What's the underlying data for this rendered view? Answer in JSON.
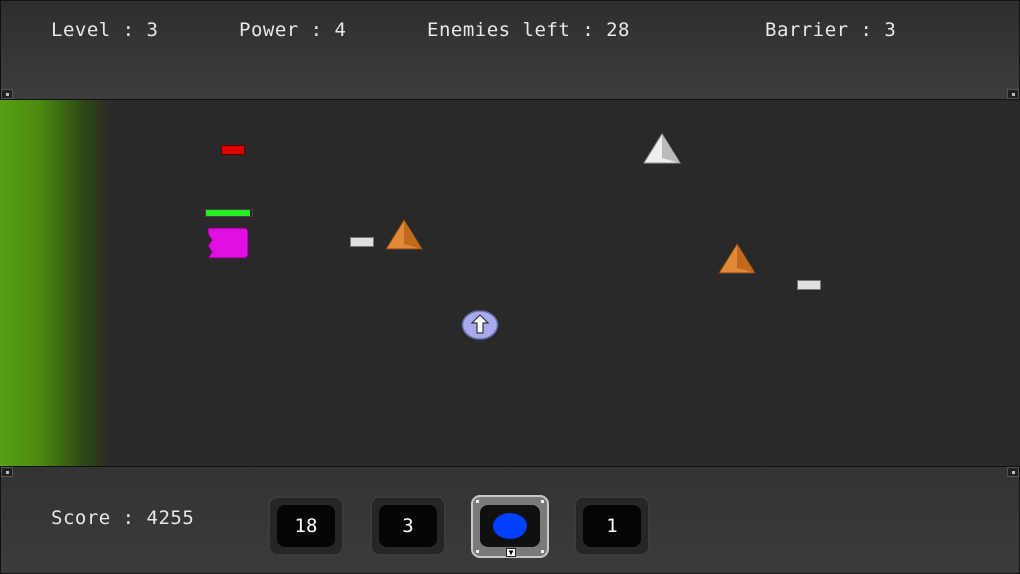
{
  "hud_top": {
    "level_label": "Level : 3",
    "power_label": "Power : 4",
    "enemies_label": "Enemies left : 28",
    "barrier_label": "Barrier : 3"
  },
  "hud_bottom": {
    "score_label": "Score : 4255",
    "slots": [
      {
        "label": "18",
        "selected": false
      },
      {
        "label": "3",
        "selected": false
      },
      {
        "label": "",
        "icon": "blue-orb-icon",
        "selected": true
      },
      {
        "label": "1",
        "selected": false
      }
    ]
  },
  "colors": {
    "barrier_green": "#56a010",
    "player_magenta": "#e010e0",
    "health_green": "#22ee22",
    "enemy_orange": "#e08a38",
    "enemy_white": "#eeeeee",
    "enemy_marker_red": "#dd0000",
    "bullet_white": "#e0e0e0",
    "powerup_lavender": "#aaaaee",
    "weapon_orb_blue": "#0040ff"
  },
  "player": {
    "health_fraction": 0.95
  }
}
